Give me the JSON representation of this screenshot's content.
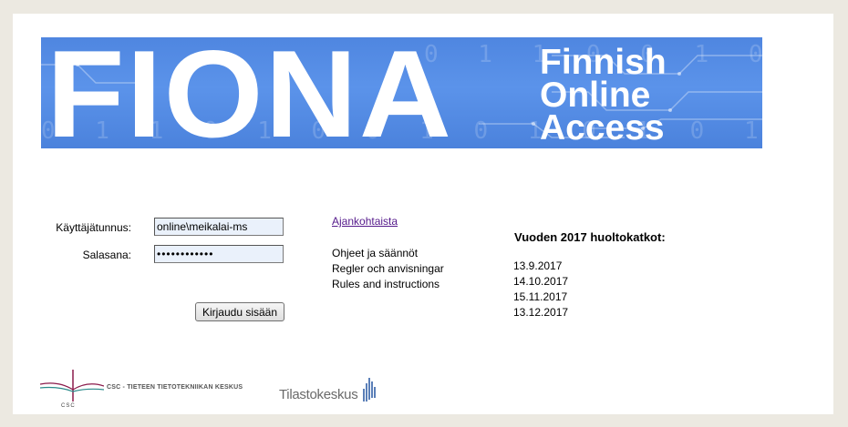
{
  "banner": {
    "big_text": "FIONA",
    "sub_line1": "Finnish",
    "sub_line2": "Online",
    "sub_line3": "Access",
    "binary_top": "0 1 1 0 0 1 0",
    "binary_bottom": "0 1 1 0 1 0 0 1 0 1 0 1 0 1 1 0 1 0 1 0 1"
  },
  "login": {
    "username_label": "Käyttäjätunnus:",
    "username_value": "online\\meikalai-ms",
    "password_label": "Salasana:",
    "password_value": "••••••••••••",
    "submit_label": "Kirjaudu sisään"
  },
  "links": {
    "news": "Ajankohtaista",
    "info_fi": "Ohjeet ja säännöt",
    "info_sv": "Regler och anvisningar",
    "info_en": "Rules and instructions"
  },
  "maintenance": {
    "title": "Vuoden 2017 huoltokatkot:",
    "dates": [
      "13.9.2017",
      "14.10.2017",
      "15.11.2017",
      "13.12.2017"
    ]
  },
  "logos": {
    "csc_name": "CSC - TIETEEN TIETOTEKNIIKAN KESKUS",
    "csc_abbr": "CSC",
    "tilastokeskus": "Tilastokeskus"
  },
  "colors": {
    "banner_blue": "#5b93ea",
    "link_visited": "#551a8b",
    "field_bg": "#eaf1fb",
    "page_bg": "#ece9e1"
  }
}
